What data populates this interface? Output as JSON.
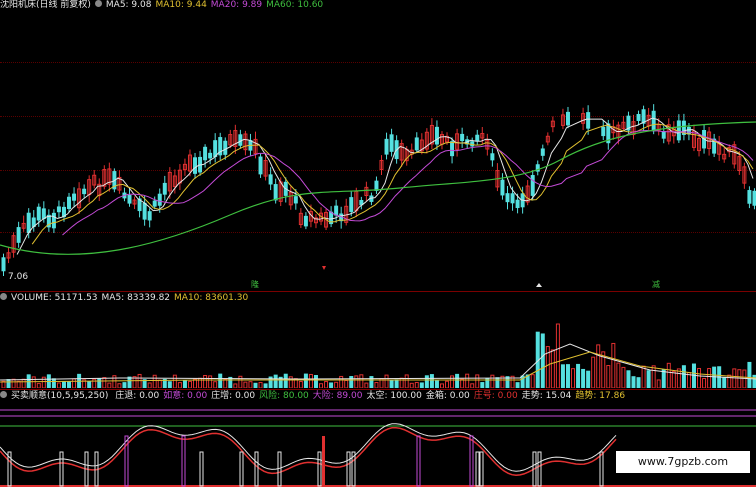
{
  "price_panel": {
    "title": "沈阳机床(日线 前复权)",
    "ma5": "MA5: 9.08",
    "ma10": "MA10: 9.44",
    "ma20": "MA20: 9.89",
    "ma60": "MA60: 10.60",
    "low_mark": "7.06",
    "marker_left": "隆",
    "marker_right": "减"
  },
  "volume_panel": {
    "volume": "VOLUME: 51171.53",
    "ma5": "MA5: 83339.82",
    "ma10": "MA10: 83601.30"
  },
  "indicator_panel": {
    "name": "买卖顺意(10,5,95,250)",
    "items": [
      {
        "text": "庄退: 0.00",
        "color": "#e6e6e6"
      },
      {
        "text": "如意: 0.00",
        "color": "#c34bd6"
      },
      {
        "text": "庄增: 0.00",
        "color": "#e6e6e6"
      },
      {
        "text": "风险: 80.00",
        "color": "#3fbf3f"
      },
      {
        "text": "大险: 89.00",
        "color": "#c34bd6"
      },
      {
        "text": "太空: 100.00",
        "color": "#e6e6e6"
      },
      {
        "text": "金箱: 0.00",
        "color": "#e6e6e6"
      },
      {
        "text": "庄号: 0.00",
        "color": "#e03030"
      },
      {
        "text": "走势: 15.04",
        "color": "#e6e6e6"
      },
      {
        "text": "趋势: 17.86",
        "color": "#e0c030"
      }
    ]
  },
  "watermark": "www.7gpzb.com",
  "colors": {
    "up": "#e03030",
    "down": "#55e0e0",
    "ma5": "#e6e6e6",
    "ma10": "#e0c030",
    "ma20": "#c34bd6",
    "ma60": "#3fbf3f",
    "separator": "#7a0000"
  }
}
